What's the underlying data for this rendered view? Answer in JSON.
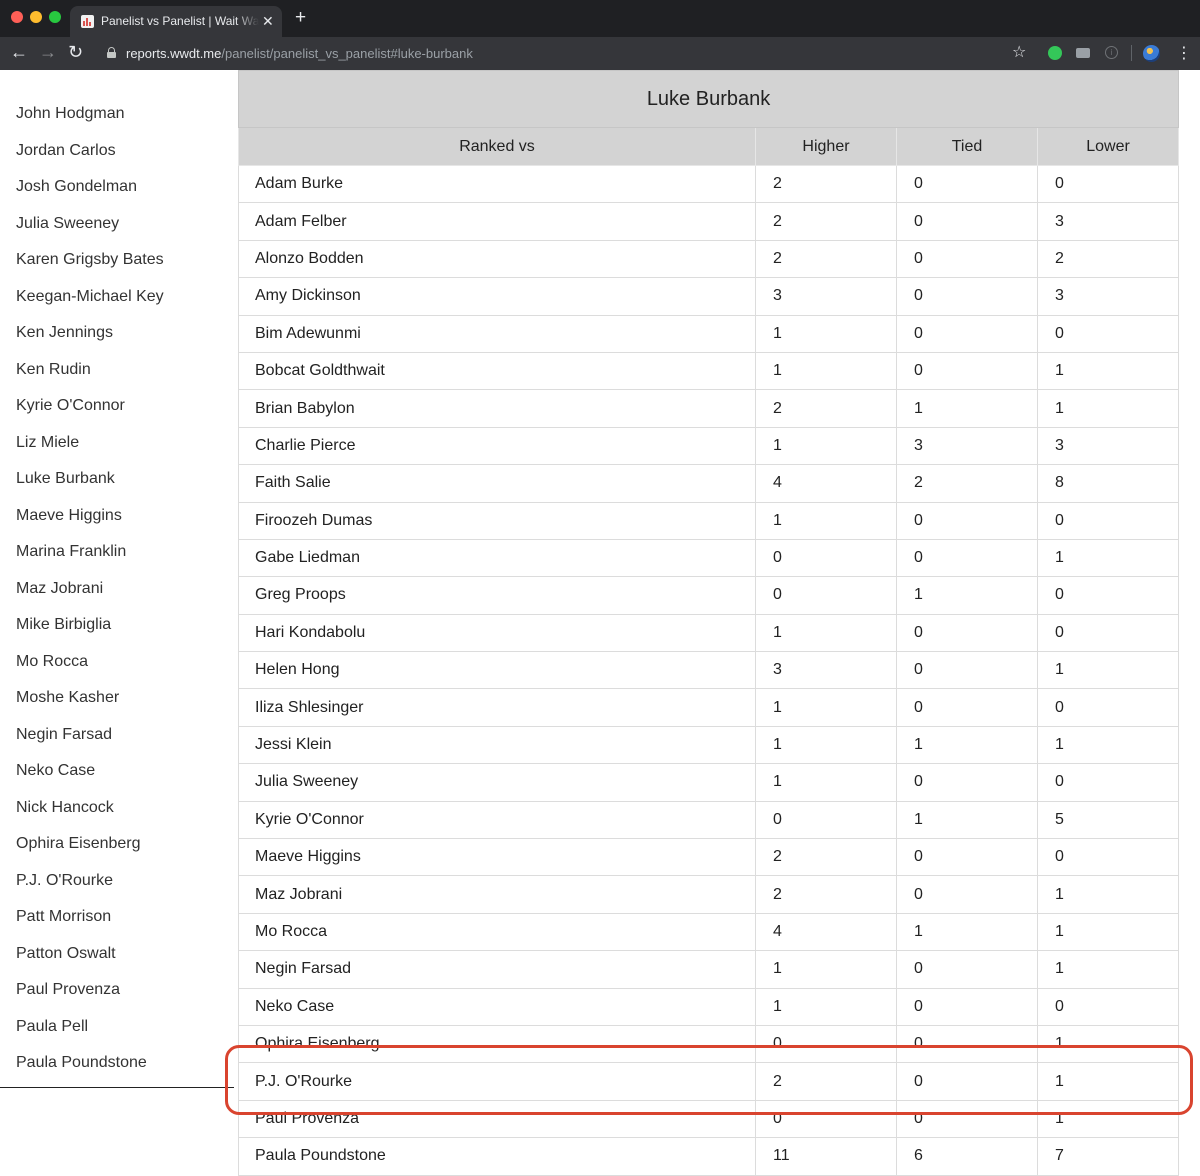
{
  "browser": {
    "tab_title": "Panelist vs Panelist | Wait Wait Don't Tell Me",
    "url_host": "reports.wwdt.me",
    "url_path": "/panelist/panelist_vs_panelist#luke-burbank",
    "tab_close": "✕",
    "new_tab": "+"
  },
  "sidebar": {
    "items": [
      "John Hodgman",
      "Jordan Carlos",
      "Josh Gondelman",
      "Julia Sweeney",
      "Karen Grigsby Bates",
      "Keegan-Michael Key",
      "Ken Jennings",
      "Ken Rudin",
      "Kyrie O'Connor",
      "Liz Miele",
      "Luke Burbank",
      "Maeve Higgins",
      "Marina Franklin",
      "Maz Jobrani",
      "Mike Birbiglia",
      "Mo Rocca",
      "Moshe Kasher",
      "Negin Farsad",
      "Neko Case",
      "Nick Hancock",
      "Ophira Eisenberg",
      "P.J. O'Rourke",
      "Patt Morrison",
      "Patton Oswalt",
      "Paul Provenza",
      "Paula Pell",
      "Paula Poundstone"
    ]
  },
  "table": {
    "title": "Luke Burbank",
    "headers": [
      "Ranked vs",
      "Higher",
      "Tied",
      "Lower"
    ],
    "rows": [
      [
        "Adam Burke",
        "2",
        "0",
        "0"
      ],
      [
        "Adam Felber",
        "2",
        "0",
        "3"
      ],
      [
        "Alonzo Bodden",
        "2",
        "0",
        "2"
      ],
      [
        "Amy Dickinson",
        "3",
        "0",
        "3"
      ],
      [
        "Bim Adewunmi",
        "1",
        "0",
        "0"
      ],
      [
        "Bobcat Goldthwait",
        "1",
        "0",
        "1"
      ],
      [
        "Brian Babylon",
        "2",
        "1",
        "1"
      ],
      [
        "Charlie Pierce",
        "1",
        "3",
        "3"
      ],
      [
        "Faith Salie",
        "4",
        "2",
        "8"
      ],
      [
        "Firoozeh Dumas",
        "1",
        "0",
        "0"
      ],
      [
        "Gabe Liedman",
        "0",
        "0",
        "1"
      ],
      [
        "Greg Proops",
        "0",
        "1",
        "0"
      ],
      [
        "Hari Kondabolu",
        "1",
        "0",
        "0"
      ],
      [
        "Helen Hong",
        "3",
        "0",
        "1"
      ],
      [
        "Iliza Shlesinger",
        "1",
        "0",
        "0"
      ],
      [
        "Jessi Klein",
        "1",
        "1",
        "1"
      ],
      [
        "Julia Sweeney",
        "1",
        "0",
        "0"
      ],
      [
        "Kyrie O'Connor",
        "0",
        "1",
        "5"
      ],
      [
        "Maeve Higgins",
        "2",
        "0",
        "0"
      ],
      [
        "Maz Jobrani",
        "2",
        "0",
        "1"
      ],
      [
        "Mo Rocca",
        "4",
        "1",
        "1"
      ],
      [
        "Negin Farsad",
        "1",
        "0",
        "1"
      ],
      [
        "Neko Case",
        "1",
        "0",
        "0"
      ],
      [
        "Ophira Eisenberg",
        "0",
        "0",
        "1"
      ],
      [
        "P.J. O'Rourke",
        "2",
        "0",
        "1"
      ],
      [
        "Paul Provenza",
        "0",
        "0",
        "1"
      ],
      [
        "Paula Poundstone",
        "11",
        "6",
        "7"
      ]
    ]
  },
  "annotation": {
    "highlighted_row": "P.J. O'Rourke",
    "color": "#d9442f"
  },
  "colors": {
    "header_bg": "#d3d3d3",
    "chrome_bg": "#35363a"
  }
}
